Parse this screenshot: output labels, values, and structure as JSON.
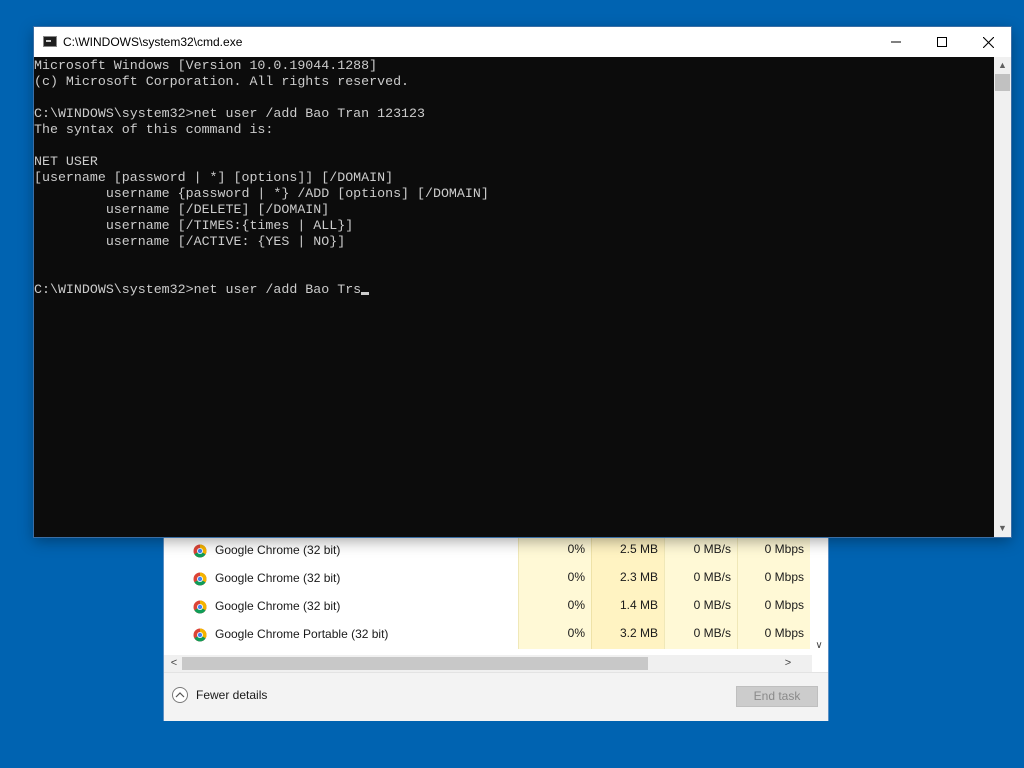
{
  "task_manager": {
    "rows": [
      {
        "name": "Google Chrome (32 bit)",
        "cpu": "0%",
        "memory": "2.5 MB",
        "disk": "0 MB/s",
        "network": "0 Mbps"
      },
      {
        "name": "Google Chrome (32 bit)",
        "cpu": "0%",
        "memory": "2.3 MB",
        "disk": "0 MB/s",
        "network": "0 Mbps"
      },
      {
        "name": "Google Chrome (32 bit)",
        "cpu": "0%",
        "memory": "1.4 MB",
        "disk": "0 MB/s",
        "network": "0 Mbps"
      },
      {
        "name": "Google Chrome Portable (32 bit)",
        "cpu": "0%",
        "memory": "3.2 MB",
        "disk": "0 MB/s",
        "network": "0 Mbps"
      }
    ],
    "fewer_details_label": "Fewer details",
    "end_task_label": "End task",
    "row_icon": "chrome-icon"
  },
  "cmd_window": {
    "title": "C:\\WINDOWS\\system32\\cmd.exe",
    "lines": [
      "Microsoft Windows [Version 10.0.19044.1288]",
      "(c) Microsoft Corporation. All rights reserved.",
      "",
      "C:\\WINDOWS\\system32>net user /add Bao Tran 123123",
      "The syntax of this command is:",
      "",
      "NET USER",
      "[username [password | *] [options]] [/DOMAIN]",
      "         username {password | *} /ADD [options] [/DOMAIN]",
      "         username [/DELETE] [/DOMAIN]",
      "         username [/TIMES:{times | ALL}]",
      "         username [/ACTIVE: {YES | NO}]",
      "",
      "",
      "C:\\WINDOWS\\system32>net user /add Bao Trs"
    ],
    "colors": {
      "background": "#0c0c0c",
      "text": "#cccccc"
    }
  },
  "desktop": {
    "background_color": "#0063b1"
  }
}
